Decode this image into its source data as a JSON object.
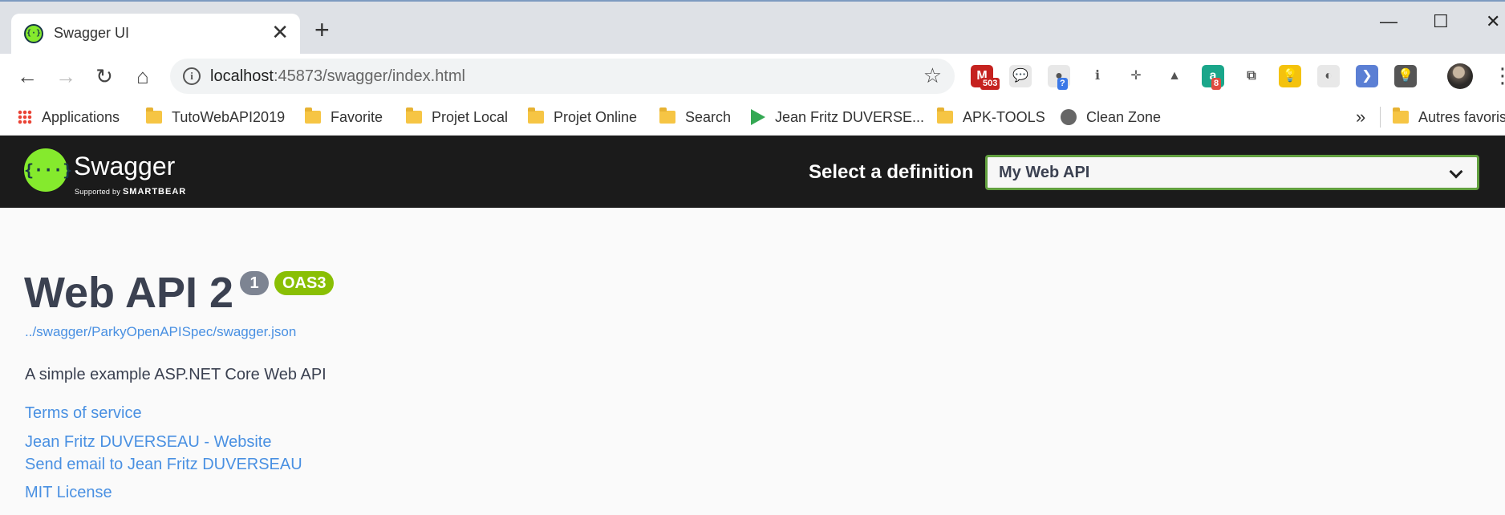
{
  "browser": {
    "tab_title": "Swagger UI",
    "tab_close": "✕",
    "new_tab": "+",
    "window_controls": {
      "minimize": "—",
      "maximize": "☐",
      "close": "✕"
    },
    "url_host": "localhost",
    "url_rest": ":45873/swagger/index.html",
    "back": "←",
    "forward": "→",
    "reload": "↻",
    "home": "⌂",
    "star": "☆",
    "menu": "⋮",
    "extensions": [
      {
        "name": "gmail-icon",
        "glyph": "M",
        "color": "#c5221f",
        "badge": "503",
        "badge_color": "#c5221f"
      },
      {
        "name": "chat-bubble-icon",
        "glyph": "💬",
        "color": "#e8e8e8",
        "badge": "",
        "badge_color": ""
      },
      {
        "name": "speech-icon",
        "glyph": "●",
        "color": "#e8e8e8",
        "badge": "?",
        "badge_color": "#3b78e7"
      },
      {
        "name": "info-person-icon",
        "glyph": "ℹ",
        "color": "#ffffff",
        "badge": "",
        "badge_color": ""
      },
      {
        "name": "move-cross-icon",
        "glyph": "✛",
        "color": "#ffffff",
        "badge": "",
        "badge_color": ""
      },
      {
        "name": "google-drive-icon",
        "glyph": "▲",
        "color": "#ffffff",
        "badge": "",
        "badge_color": ""
      },
      {
        "name": "a-letter-icon",
        "glyph": "a",
        "color": "#1aa68a",
        "badge": "8",
        "badge_color": "#e04a3f"
      },
      {
        "name": "screen-share-icon",
        "glyph": "⧉",
        "color": "#ffffff",
        "badge": "",
        "badge_color": ""
      },
      {
        "name": "lightbulb-icon",
        "glyph": "💡",
        "color": "#f4c20d",
        "badge": "",
        "badge_color": ""
      },
      {
        "name": "dark-mode-icon",
        "glyph": "◐",
        "color": "#e8e8e8",
        "badge": "",
        "badge_color": ""
      },
      {
        "name": "feather-icon",
        "glyph": "❯",
        "color": "#5b7fd4",
        "badge": "",
        "badge_color": ""
      },
      {
        "name": "lightbulb-dark-icon",
        "glyph": "💡",
        "color": "#555555",
        "badge": "",
        "badge_color": ""
      }
    ],
    "bookmarks": [
      {
        "name": "bookmark-applications",
        "label": "Applications",
        "icon": "apps"
      },
      {
        "name": "bookmark-tutowebapi2019",
        "label": "TutoWebAPI2019",
        "icon": "folder"
      },
      {
        "name": "bookmark-favorite",
        "label": "Favorite",
        "icon": "folder"
      },
      {
        "name": "bookmark-projet-local",
        "label": "Projet Local",
        "icon": "folder"
      },
      {
        "name": "bookmark-projet-online",
        "label": "Projet Online",
        "icon": "folder"
      },
      {
        "name": "bookmark-search",
        "label": "Search",
        "icon": "folder"
      },
      {
        "name": "bookmark-jean-fritz",
        "label": "Jean Fritz DUVERSE...",
        "icon": "play"
      },
      {
        "name": "bookmark-apk-tools",
        "label": "APK-TOOLS",
        "icon": "folder"
      },
      {
        "name": "bookmark-clean-zone",
        "label": "Clean Zone",
        "icon": "globe"
      }
    ],
    "bookmarks_overflow": "»",
    "other_bookmarks": "Autres favoris"
  },
  "swagger_bar": {
    "logo_glyph": "{···}",
    "wordmark": "Swagger",
    "tagline_prefix": "Supported by ",
    "tagline_brand": "SMARTBEAR",
    "definition_label": "Select a definition",
    "definition_selected": "My Web API"
  },
  "info": {
    "title": "Web API 2",
    "version": "1",
    "oas_badge": "OAS3",
    "spec_url": "../swagger/ParkyOpenAPISpec/swagger.json",
    "description": "A simple example ASP.NET Core Web API",
    "terms": "Terms of service",
    "contact_website": "Jean Fritz DUVERSEAU - Website",
    "contact_email": "Send email to Jean Fritz DUVERSEAU",
    "license": "MIT License"
  },
  "colors": {
    "swagger_green": "#85ea2d",
    "topbar_bg": "#1b1b1b",
    "select_border": "#62a03f",
    "version_badge": "#7d8492",
    "oas_badge": "#89bf04",
    "link": "#4990e2",
    "title": "#3b4151"
  }
}
